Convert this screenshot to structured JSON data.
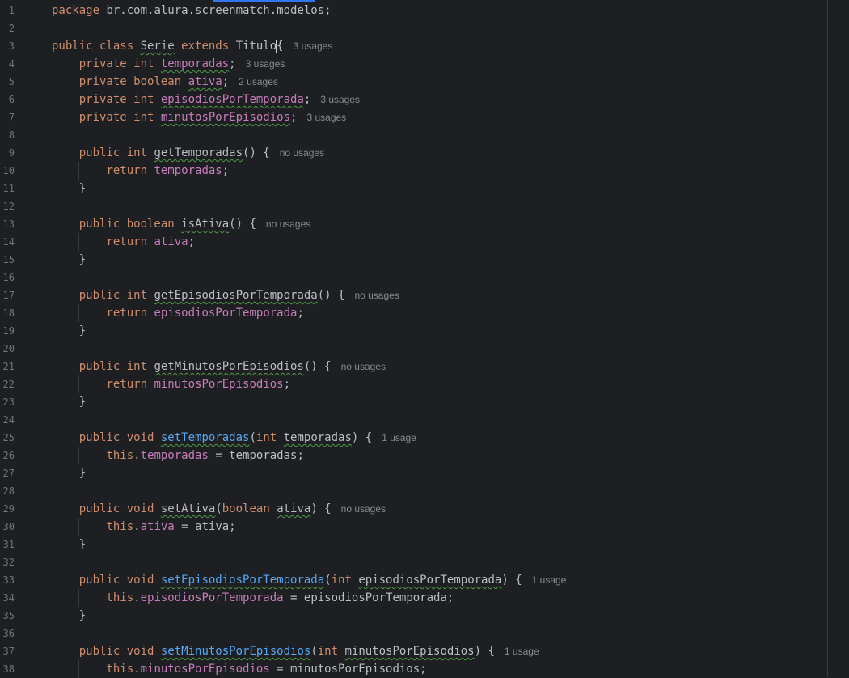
{
  "editor": {
    "lines": [
      {
        "n": "1",
        "parts": [
          [
            "kw",
            "package "
          ],
          [
            "",
            "br.com.alura.screenmatch.modelos;"
          ]
        ]
      },
      {
        "n": "2",
        "parts": []
      },
      {
        "n": "3",
        "parts": [
          [
            "kw",
            "public class "
          ],
          [
            "sq",
            "Serie"
          ],
          [
            "kw",
            " extends "
          ],
          [
            "",
            "Titulo{"
          ]
        ],
        "usages": "3 usages"
      },
      {
        "n": "4",
        "parts": [
          [
            "",
            "    "
          ],
          [
            "kw",
            "private int "
          ],
          [
            "fld sq",
            "temporadas"
          ],
          [
            "",
            ";"
          ]
        ],
        "usages": "3 usages"
      },
      {
        "n": "5",
        "parts": [
          [
            "",
            "    "
          ],
          [
            "kw",
            "private boolean "
          ],
          [
            "fld sq",
            "ativa"
          ],
          [
            "",
            ";"
          ]
        ],
        "usages": "2 usages"
      },
      {
        "n": "6",
        "parts": [
          [
            "",
            "    "
          ],
          [
            "kw",
            "private int "
          ],
          [
            "fld sq",
            "episodiosPorTemporada"
          ],
          [
            "",
            ";"
          ]
        ],
        "usages": "3 usages"
      },
      {
        "n": "7",
        "parts": [
          [
            "",
            "    "
          ],
          [
            "kw",
            "private int "
          ],
          [
            "fld sq",
            "minutosPorEpisodios"
          ],
          [
            "",
            ";"
          ]
        ],
        "usages": "3 usages"
      },
      {
        "n": "8",
        "parts": []
      },
      {
        "n": "9",
        "parts": [
          [
            "",
            "    "
          ],
          [
            "kw",
            "public int "
          ],
          [
            "sq",
            "getTemporadas"
          ],
          [
            "",
            "() {"
          ]
        ],
        "usages": "no usages"
      },
      {
        "n": "10",
        "parts": [
          [
            "",
            "        "
          ],
          [
            "kw",
            "return "
          ],
          [
            "fld",
            "temporadas"
          ],
          [
            "",
            ";"
          ]
        ]
      },
      {
        "n": "11",
        "parts": [
          [
            "",
            "    }"
          ]
        ]
      },
      {
        "n": "12",
        "parts": []
      },
      {
        "n": "13",
        "parts": [
          [
            "",
            "    "
          ],
          [
            "kw",
            "public boolean "
          ],
          [
            "sq",
            "isAtiva"
          ],
          [
            "",
            "() {"
          ]
        ],
        "usages": "no usages"
      },
      {
        "n": "14",
        "parts": [
          [
            "",
            "        "
          ],
          [
            "kw",
            "return "
          ],
          [
            "fld",
            "ativa"
          ],
          [
            "",
            ";"
          ]
        ]
      },
      {
        "n": "15",
        "parts": [
          [
            "",
            "    }"
          ]
        ]
      },
      {
        "n": "16",
        "parts": []
      },
      {
        "n": "17",
        "parts": [
          [
            "",
            "    "
          ],
          [
            "kw",
            "public int "
          ],
          [
            "sq",
            "getEpisodiosPorTemporada"
          ],
          [
            "",
            "() {"
          ]
        ],
        "usages": "no usages"
      },
      {
        "n": "18",
        "parts": [
          [
            "",
            "        "
          ],
          [
            "kw",
            "return "
          ],
          [
            "fld",
            "episodiosPorTemporada"
          ],
          [
            "",
            ";"
          ]
        ]
      },
      {
        "n": "19",
        "parts": [
          [
            "",
            "    }"
          ]
        ]
      },
      {
        "n": "20",
        "parts": []
      },
      {
        "n": "21",
        "parts": [
          [
            "",
            "    "
          ],
          [
            "kw",
            "public int "
          ],
          [
            "sq",
            "getMinutosPorEpisodios"
          ],
          [
            "",
            "() {"
          ]
        ],
        "usages": "no usages"
      },
      {
        "n": "22",
        "parts": [
          [
            "",
            "        "
          ],
          [
            "kw",
            "return "
          ],
          [
            "fld",
            "minutosPorEpisodios"
          ],
          [
            "",
            ";"
          ]
        ]
      },
      {
        "n": "23",
        "parts": [
          [
            "",
            "    }"
          ]
        ]
      },
      {
        "n": "24",
        "parts": []
      },
      {
        "n": "25",
        "parts": [
          [
            "",
            "    "
          ],
          [
            "kw",
            "public void "
          ],
          [
            "mth sq",
            "setTemporadas"
          ],
          [
            "",
            "("
          ],
          [
            "kw",
            "int "
          ],
          [
            "sq",
            "temporadas"
          ],
          [
            "",
            ") {"
          ]
        ],
        "usages": "1 usage"
      },
      {
        "n": "26",
        "parts": [
          [
            "",
            "        "
          ],
          [
            "kw",
            "this"
          ],
          [
            "",
            "."
          ],
          [
            "fld",
            "temporadas"
          ],
          [
            "",
            " = temporadas;"
          ]
        ]
      },
      {
        "n": "27",
        "parts": [
          [
            "",
            "    }"
          ]
        ]
      },
      {
        "n": "28",
        "parts": []
      },
      {
        "n": "29",
        "parts": [
          [
            "",
            "    "
          ],
          [
            "kw",
            "public void "
          ],
          [
            "sq",
            "setAtiva"
          ],
          [
            "",
            "("
          ],
          [
            "kw",
            "boolean "
          ],
          [
            "sq",
            "ativa"
          ],
          [
            "",
            ") {"
          ]
        ],
        "usages": "no usages"
      },
      {
        "n": "30",
        "parts": [
          [
            "",
            "        "
          ],
          [
            "kw",
            "this"
          ],
          [
            "",
            "."
          ],
          [
            "fld",
            "ativa"
          ],
          [
            "",
            " = ativa;"
          ]
        ]
      },
      {
        "n": "31",
        "parts": [
          [
            "",
            "    }"
          ]
        ]
      },
      {
        "n": "32",
        "parts": []
      },
      {
        "n": "33",
        "parts": [
          [
            "",
            "    "
          ],
          [
            "kw",
            "public void "
          ],
          [
            "mth sq",
            "setEpisodiosPorTemporada"
          ],
          [
            "",
            "("
          ],
          [
            "kw",
            "int "
          ],
          [
            "sq",
            "episodiosPorTemporada"
          ],
          [
            "",
            ") {"
          ]
        ],
        "usages": "1 usage"
      },
      {
        "n": "34",
        "parts": [
          [
            "",
            "        "
          ],
          [
            "kw",
            "this"
          ],
          [
            "",
            "."
          ],
          [
            "fld",
            "episodiosPorTemporada"
          ],
          [
            "",
            " = episodiosPorTemporada;"
          ]
        ]
      },
      {
        "n": "35",
        "parts": [
          [
            "",
            "    }"
          ]
        ]
      },
      {
        "n": "36",
        "parts": []
      },
      {
        "n": "37",
        "parts": [
          [
            "",
            "    "
          ],
          [
            "kw",
            "public void "
          ],
          [
            "mth sq",
            "setMinutosPorEpisodios"
          ],
          [
            "",
            "("
          ],
          [
            "kw",
            "int "
          ],
          [
            "sq",
            "minutosPorEpisodios"
          ],
          [
            "",
            ") {"
          ]
        ],
        "usages": "1 usage"
      },
      {
        "n": "38",
        "parts": [
          [
            "",
            "        "
          ],
          [
            "kw",
            "this"
          ],
          [
            "",
            "."
          ],
          [
            "fld",
            "minutosPorEpisodios"
          ],
          [
            "",
            " = minutosPorEpisodios;"
          ]
        ]
      }
    ]
  },
  "colors": {
    "background": "#1e1f22",
    "keyword": "#cf8e6d",
    "field": "#c77dbb",
    "method": "#56a8f5",
    "text": "#bcbec4",
    "line_number": "#6f737a",
    "inlay_hint": "#868a91"
  }
}
